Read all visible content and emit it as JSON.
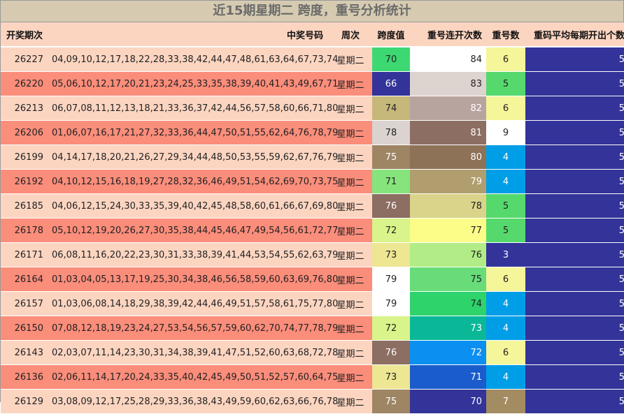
{
  "title": "近15期星期二 跨度，重号分析统计",
  "headers": [
    "开奖期次",
    "中奖号码",
    "周次",
    "跨度值",
    "重号连开次数",
    "重号数",
    "重码平均每期开出个数"
  ],
  "rows": [
    {
      "id": "26227",
      "nums": "04,09,10,12,17,18,22,28,33,38,42,44,47,48,61,63,64,67,73,74",
      "week": "星期二",
      "span": "70",
      "cnt": "84",
      "rep": "6",
      "avg": "5"
    },
    {
      "id": "26220",
      "nums": "05,06,10,12,17,20,21,23,24,25,33,35,38,39,40,41,43,49,67,71",
      "week": "星期二",
      "span": "66",
      "cnt": "83",
      "rep": "5",
      "avg": "5"
    },
    {
      "id": "26213",
      "nums": "06,07,08,11,12,13,18,21,33,36,37,42,44,56,57,58,60,66,71,80",
      "week": "星期二",
      "span": "74",
      "cnt": "82",
      "rep": "6",
      "avg": "5"
    },
    {
      "id": "26206",
      "nums": "01,06,07,16,17,21,27,32,33,36,44,47,50,51,55,62,64,76,78,79",
      "week": "星期二",
      "span": "78",
      "cnt": "81",
      "rep": "9",
      "avg": "5"
    },
    {
      "id": "26199",
      "nums": "04,14,17,18,20,21,26,27,29,34,44,48,50,53,55,59,62,67,76,79",
      "week": "星期二",
      "span": "75",
      "cnt": "80",
      "rep": "4",
      "avg": "5"
    },
    {
      "id": "26192",
      "nums": "04,10,12,15,16,18,19,27,28,32,36,46,49,51,54,62,69,70,73,75",
      "week": "星期二",
      "span": "71",
      "cnt": "79",
      "rep": "4",
      "avg": "5"
    },
    {
      "id": "26185",
      "nums": "04,06,12,15,24,30,33,35,39,40,42,45,48,58,60,61,66,67,69,80",
      "week": "星期二",
      "span": "76",
      "cnt": "78",
      "rep": "5",
      "avg": "5"
    },
    {
      "id": "26178",
      "nums": "05,10,12,19,20,26,27,30,35,38,44,45,46,47,49,54,56,61,72,77",
      "week": "星期二",
      "span": "72",
      "cnt": "77",
      "rep": "5",
      "avg": "5"
    },
    {
      "id": "26171",
      "nums": "06,08,11,16,20,22,23,30,31,33,38,39,41,44,53,54,55,62,63,79",
      "week": "星期二",
      "span": "73",
      "cnt": "76",
      "rep": "3",
      "avg": "5"
    },
    {
      "id": "26164",
      "nums": "01,03,04,05,13,17,19,25,30,34,38,46,56,58,59,60,63,69,76,80",
      "week": "星期二",
      "span": "79",
      "cnt": "75",
      "rep": "6",
      "avg": "5"
    },
    {
      "id": "26157",
      "nums": "01,03,06,08,14,18,29,38,39,42,44,46,49,51,57,58,61,75,77,80",
      "week": "星期二",
      "span": "79",
      "cnt": "74",
      "rep": "4",
      "avg": "5"
    },
    {
      "id": "26150",
      "nums": "07,08,12,18,19,23,24,27,53,54,56,57,59,60,62,70,74,77,78,79",
      "week": "星期二",
      "span": "72",
      "cnt": "73",
      "rep": "4",
      "avg": "5"
    },
    {
      "id": "26143",
      "nums": "02,03,07,11,14,23,30,31,34,38,39,41,47,51,52,60,63,68,72,78",
      "week": "星期二",
      "span": "76",
      "cnt": "72",
      "rep": "6",
      "avg": "5"
    },
    {
      "id": "26136",
      "nums": "02,06,11,14,17,20,24,33,35,40,42,45,49,50,51,52,57,60,64,75",
      "week": "星期二",
      "span": "73",
      "cnt": "71",
      "rep": "4",
      "avg": "5"
    },
    {
      "id": "26129",
      "nums": "03,08,09,12,17,25,28,29,33,36,38,43,49,59,60,62,63,66,76,78",
      "week": "星期二",
      "span": "75",
      "cnt": "70",
      "rep": "7",
      "avg": "5"
    }
  ],
  "colors": {
    "row_odd": "#fcd5c1",
    "row_even": "#fb8d7b",
    "avg": "#33339a",
    "span": {
      "66": "#33339a",
      "70": "#3dd872",
      "71": "#86e47c",
      "72": "#d8f48a",
      "73": "#ede692",
      "74": "#c6b77a",
      "75": "#9e8564",
      "76": "#8c6e62",
      "78": "#dad3cf",
      "79": "#ffffff"
    },
    "cnt": [
      "#ffffff",
      "#ddd4d0",
      "#b8a49f",
      "#8c6e62",
      "#8d7258",
      "#b09e6e",
      "#dad48a",
      "#fcfc88",
      "#b2ec86",
      "#68dc78",
      "#2ed36c",
      "#0ab898",
      "#0b8ff0",
      "#1a5ccc",
      "#33339a"
    ],
    "rep": {
      "3": "#33339a",
      "4": "#009ee6",
      "5": "#55d96d",
      "6": "#f5f59a",
      "7": "#a38b62",
      "9": "#ffffff"
    }
  }
}
